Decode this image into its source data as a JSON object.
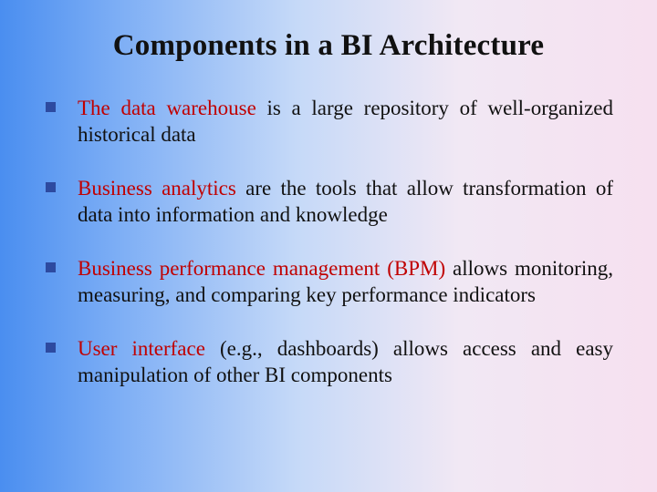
{
  "slide": {
    "title": "Components in a BI Architecture",
    "bullets": [
      {
        "lead": "The data warehouse",
        "rest": " is a large repository of well-organized historical data"
      },
      {
        "lead": "Business analytics",
        "rest": " are the tools that allow transformation of data into information and knowledge"
      },
      {
        "lead": "Business performance management (BPM)",
        "rest": " allows monitoring, measuring, and comparing key performance indicators"
      },
      {
        "lead": "User interface",
        "rest": " (e.g., dashboards) allows access and easy manipulation of other BI components"
      }
    ]
  }
}
